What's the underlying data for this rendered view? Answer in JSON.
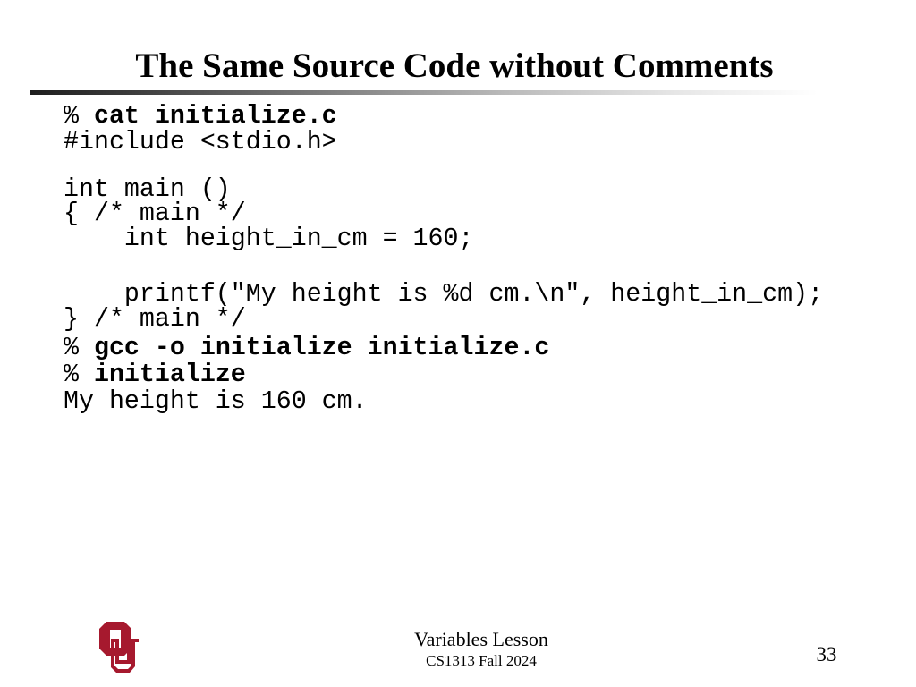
{
  "slide": {
    "title": "The Same Source Code without Comments",
    "code_lines": [
      {
        "prompt": "% ",
        "command": "cat initialize.c",
        "text": ""
      },
      {
        "prompt": "",
        "command": "",
        "text": "#include <stdio.h>"
      },
      {
        "prompt": "",
        "command": "",
        "text": "int main ()"
      },
      {
        "prompt": "",
        "command": "",
        "text": "{ /* main */"
      },
      {
        "prompt": "",
        "command": "",
        "text": "    int height_in_cm = 160;"
      },
      {
        "prompt": "",
        "command": "",
        "text": "    printf(\"My height is %d cm.\\n\", height_in_cm);"
      },
      {
        "prompt": "",
        "command": "",
        "text": "} /* main */"
      },
      {
        "prompt": "% ",
        "command": "gcc -o initialize initialize.c",
        "text": ""
      },
      {
        "prompt": "% ",
        "command": "initialize",
        "text": ""
      },
      {
        "prompt": "",
        "command": "",
        "text": "My height is 160 cm."
      }
    ],
    "footer": {
      "lesson": "Variables Lesson",
      "course": "CS1313 Fall 2024",
      "page_number": "33"
    },
    "colors": {
      "logo": "#a6192e",
      "text": "#000000"
    },
    "logo_icon": "ou-logo-icon"
  }
}
